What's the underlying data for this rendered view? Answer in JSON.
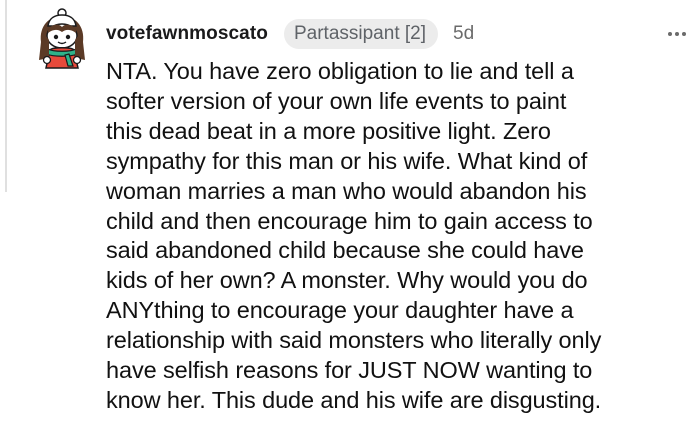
{
  "comment": {
    "username": "votefawnmoscato",
    "flair": "Partassipant [2]",
    "timestamp": "5d",
    "body_lines": [
      "NTA. You have zero obligation to lie and tell a",
      "softer version of your own life events to paint",
      "this dead beat in a more positive light. Zero",
      "sympathy for this man or his wife. What kind of",
      "woman marries a man who would abandon his",
      "child and then encourage him to gain access to",
      "said abandoned child because she could have",
      "kids of her own? A monster. Why would you do",
      "ANYthing to encourage your daughter have a",
      "relationship with said monsters who literally only",
      "have selfish reasons for JUST NOW wanting to",
      "know her. This dude and his wife are disgusting."
    ]
  },
  "icons": {
    "avatar": "snoo-avatar-icon",
    "more": "more-options-icon"
  },
  "colors": {
    "flair_background": "#ececec",
    "text": "#111111",
    "meta": "#6b6b6b"
  }
}
